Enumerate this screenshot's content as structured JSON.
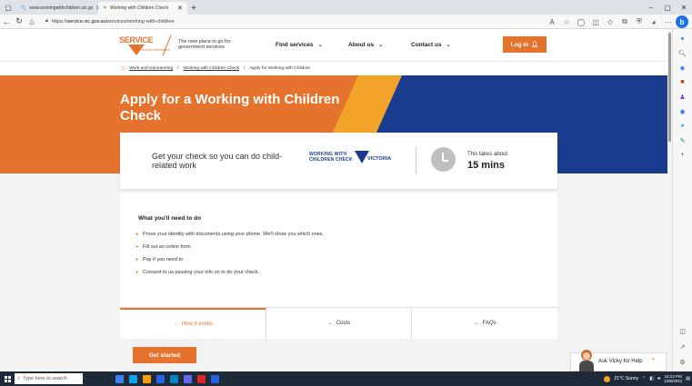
{
  "browser": {
    "tabs": [
      {
        "label": "www.workingwithchildren.vic.go",
        "active": false
      },
      {
        "label": "Working with Children Check",
        "active": true
      }
    ],
    "url_prefix": "https://",
    "url_host": "service.vic.gov.au",
    "url_path": "/services/working-with-children"
  },
  "header": {
    "logo_word": "SERVICE",
    "logo_sub": "Victoria Government",
    "tagline": "The new place to go for government services",
    "nav": [
      {
        "label": "Find services"
      },
      {
        "label": "About us"
      },
      {
        "label": "Contact us"
      }
    ],
    "login_label": "Log in"
  },
  "breadcrumbs": {
    "items": [
      "Work and volunteering",
      "Working with Children Check"
    ],
    "current": "Apply for Working with Children"
  },
  "hero": {
    "title": "Apply for a Working with Children Check"
  },
  "info": {
    "lead": "Get your check so you can do child-related work",
    "logo_line1": "WORKING WITH",
    "logo_line2": "CHILDREN CHECK",
    "logo_vic": "VICTORIA",
    "takes_label": "This takes about",
    "duration": "15 mins"
  },
  "needs": {
    "heading": "What you'll need to do",
    "items": [
      "Prove your identity with documents using your phone. We'll show you which ones.",
      "Fill out an online form",
      "Pay if you need to",
      "Consent to us passing your info on to do your check."
    ]
  },
  "tabs": [
    {
      "label": "How it works",
      "active": true
    },
    {
      "label": "Costs",
      "active": false
    },
    {
      "label": "FAQs",
      "active": false
    }
  ],
  "cta": {
    "label": "Get started"
  },
  "chat": {
    "label": "Ask Vicky for Help"
  },
  "taskbar": {
    "search_placeholder": "Type here to search",
    "weather": "21°C Sunny",
    "time": "12:24 PM",
    "date": "1/08/2021"
  },
  "colors": {
    "brand_orange": "#e6732d",
    "brand_blue": "#1a3c8f",
    "accent_yellow": "#f2a32a"
  }
}
